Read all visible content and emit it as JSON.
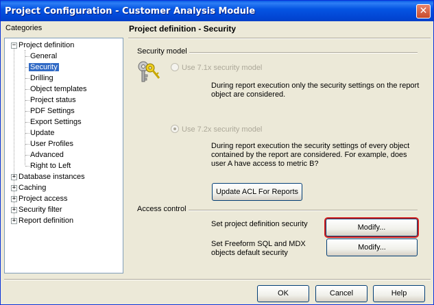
{
  "window": {
    "title": "Project Configuration - Customer Analysis Module"
  },
  "sidebar": {
    "label": "Categories",
    "root": "Project definition",
    "children": [
      "General",
      "Security",
      "Drilling",
      "Object templates",
      "Project status",
      "PDF Settings",
      "Export Settings",
      "Update",
      "User Profiles",
      "Advanced",
      "Right to Left"
    ],
    "others": [
      "Database instances",
      "Caching",
      "Project access",
      "Security filter",
      "Report definition"
    ],
    "selected": "Security"
  },
  "main": {
    "title": "Project definition - Security",
    "security_model": {
      "label": "Security model",
      "option1": "Use 7.1x security model",
      "option1_desc_l1": "During report execution only the security settings on the report",
      "option1_desc_l2": "object are considered.",
      "option2": "Use 7.2x security model",
      "option2_desc_l1": "During report execution the security settings of every object",
      "option2_desc_l2": "contained by the report are considered.  For example, does",
      "option2_desc_l3": "user A have access to metric B?",
      "update_button": "Update ACL For Reports"
    },
    "access_control": {
      "label": "Access control",
      "row1_text": "Set project definition security",
      "row1_button": "Modify...",
      "row2_text_l1": "Set Freeform SQL and MDX",
      "row2_text_l2": "objects default security",
      "row2_button": "Modify..."
    }
  },
  "footer": {
    "ok": "OK",
    "cancel": "Cancel",
    "help": "Help"
  }
}
